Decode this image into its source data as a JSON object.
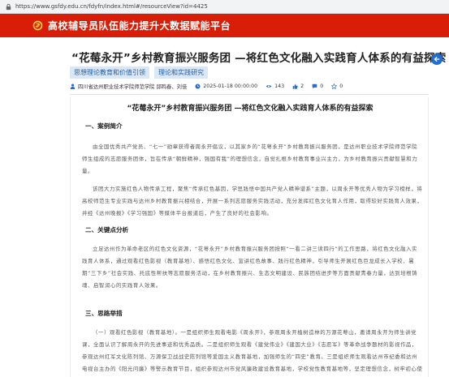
{
  "browser": {
    "url": "https://www.gsfdy.edu.cn/fdyfn/index.html#/resourceView?id=4425"
  },
  "header": {
    "site_title": "高校辅导员队伍能力提升大数据赋能平台",
    "logo_icon": "party-emblem-icon",
    "bg_color": "#d81e06"
  },
  "article": {
    "title": "“花莓永开”乡村教育振兴服务团 —将红色文化融入实践育人体系的有益探索",
    "tags": [
      "思想理论教育和价值引领",
      "理论和实践研究"
    ],
    "meta": {
      "author": "四川省达州职业技术学院师范学院 邱鸣春、刘佳",
      "date": "2025-01-18 00:00:00",
      "views": "143",
      "likes": "2",
      "comments": "0",
      "favorites": "0"
    },
    "heading": "“花莓永开”乡村教育振兴服务团 —将红色文化融入实践育人体系的有益探索",
    "sections": [
      {
        "title": "一、案例简介",
        "paragraphs": [
          "由全国优秀共产党员、“七一”勋章获得者周永开倡议，以其家乡的“花萼永开”乡村教育振兴服务团，是达州职业技术学院师范学院师生组成的志愿服务团体，旨在传承“朝鲜精神，强国有我”的理想信念，自觉扎根乡村教育事业兴主力，为乡村教育振兴贡献智慧和力量。",
          "该团大力实施红色人物传承工程，聚焦“传承红色基因，学思践悟中国共产党人精神谱系”主题，以周永开等优秀人物为学习榜样，将高校师范生专业实践与达州乡村教育振兴相结合，开展一系列志愿服务实践活动，充分发挥红色文化育人作用，取得较好实践育人效果，并经《达州晚报》《学习强国》等媒体平台报道后，产生了良好的社会影响。"
        ]
      },
      {
        "title": "二、关键点分析",
        "paragraphs": [
          "立足达州作为革命老区的红色文化资源，“花萼永开”乡村教育振兴服务团按照“一看二讲三读四行”的工作思路，将红色文化融入实践育人体系，通过观看红色影视（教育基地）、感悟红色文化、宣讲红色故事、践行红色精神，引导师生开展红色巨龙成长入学校、暑期“三下乡”社会实践、托底性帮扶等志愿服务活动，在乡村教育振兴、生态文明建设、民族团结进步等方面贡献青春力量，达到培根铸魂、启智润心的实践育人效果。"
        ]
      },
      {
        "title": "三、思路举措",
        "paragraphs": [
          "（一）观看红色影视（教育基地）。一是组织师生观看电影《周永开》，参观周永开植树造林的万源花萼山，邀请周永开为师生讲党课，全面认识了解周永开的先进事迹和优秀品质。二是组织师生观看《建党伟业》《建国大业》《志愿军》等革命战争题材的影视作品，参观达州红军文化陈列馆、万源保卫战战史陈列馆等爱国主义教育基地，加强师生的“四史”教育。三是组织师生观看达州市纪委和达州电视台主办的《阳光问廉》等警示教育节目，组织参观达州市党风廉政建设教育基地，学校党性教育基地等，坚定理想信念，树牢初心使命。"
        ]
      }
    ]
  }
}
